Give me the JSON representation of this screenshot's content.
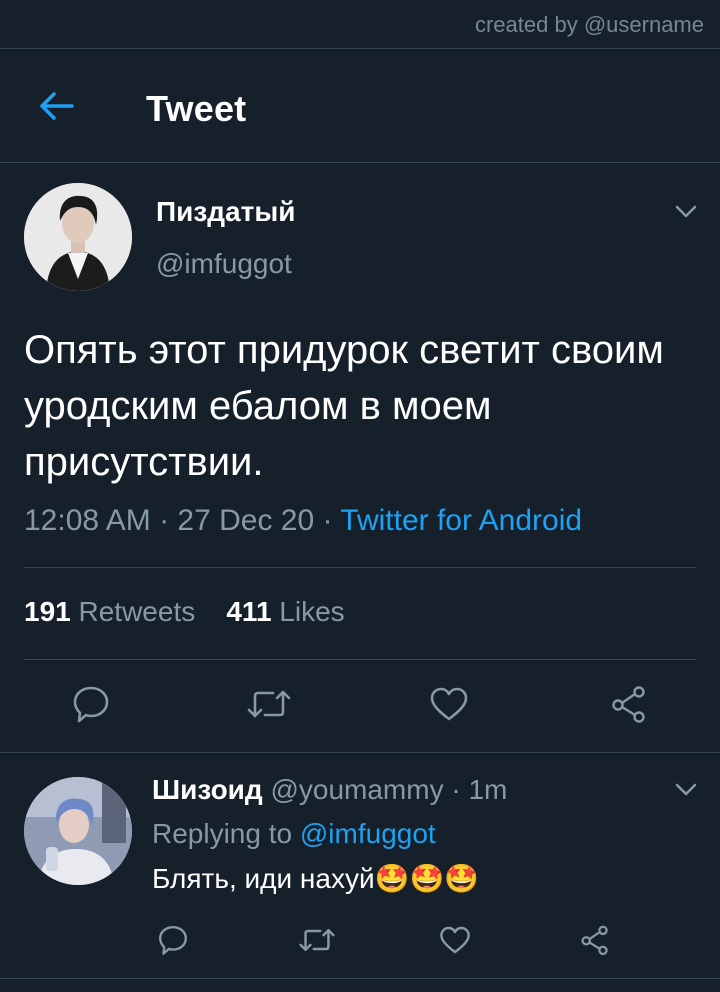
{
  "watermark": "created by @username",
  "header": {
    "title": "Tweet",
    "back_icon": "arrow-left-icon"
  },
  "tweet": {
    "author_name": "Пиздатый",
    "author_handle": "@imfuggot",
    "text": "Опять этот придурок светит своим уродским ебалом в моем присутствии.",
    "time": "12:08 AM · 27 Dec 20 · ",
    "source": "Twitter for Android",
    "retweets_count": "191",
    "retweets_label": "Retweets",
    "likes_count": "411",
    "likes_label": "Likes"
  },
  "reply": {
    "author_name": "Шизоид",
    "author_handle": "@youmammy",
    "time": " · 1m",
    "replying_prefix": "Replying to ",
    "replying_to": "@imfuggot",
    "text": "Блять, иди нахуй🤩🤩🤩"
  },
  "icons": [
    "arrow-left-icon",
    "chevron-down-icon",
    "reply-icon",
    "retweet-icon",
    "like-icon",
    "share-icon"
  ],
  "colors": {
    "background": "#15202b",
    "accent": "#1da1f2",
    "secondary_text": "#8899a6",
    "divider": "#38444d"
  }
}
